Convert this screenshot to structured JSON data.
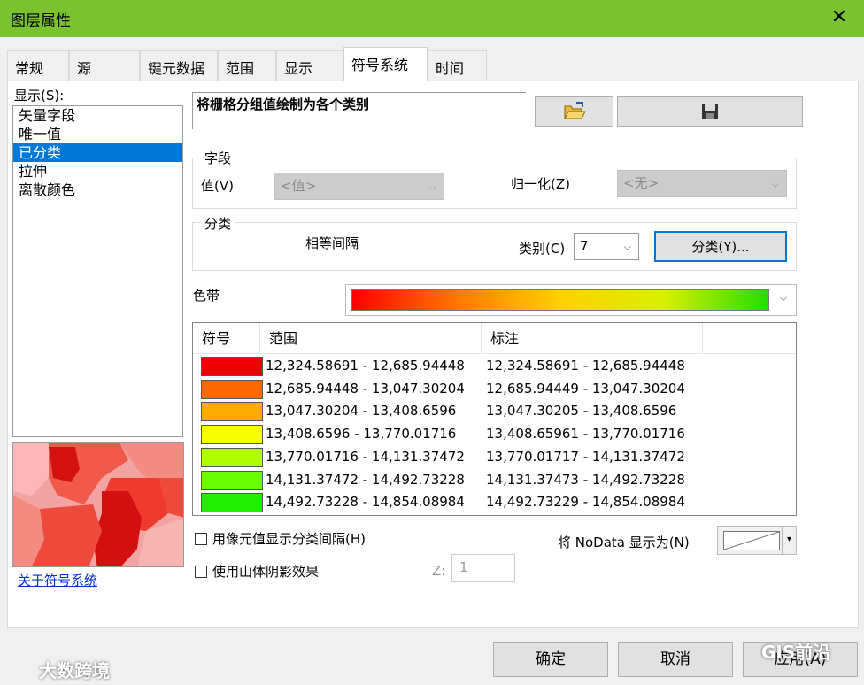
{
  "window": {
    "title": "图层属性",
    "close_glyph": "✕"
  },
  "tabs": [
    "常规",
    "源",
    "键元数据",
    "范围",
    "显示",
    "符号系统",
    "时间"
  ],
  "show_label": "显示(S):",
  "show_list": [
    "矢量字段",
    "唯一值",
    "已分类",
    "拉伸",
    "离散颜色"
  ],
  "selected_show": "已分类",
  "description": "将栅格分组值绘制为各个类别",
  "toolbar": {
    "open_icon": "folder-open-icon",
    "save_icon": "save-disk-icon"
  },
  "field_group": {
    "title": "字段",
    "value_label": "值(V)",
    "value_selected": "<值>",
    "normalize_label": "归一化(Z)",
    "normalize_selected": "<无>"
  },
  "classification_group": {
    "title": "分类",
    "method": "相等间隔",
    "classes_label": "类别(C)",
    "classes_value": "7",
    "classify_button": "分类(Y)..."
  },
  "color_ramp": {
    "label": "色带",
    "colors": [
      "#ff0000",
      "#ff7700",
      "#ffd000",
      "#d8f000",
      "#22dd00"
    ]
  },
  "table": {
    "headers": [
      "符号",
      "范围",
      "标注"
    ],
    "rows": [
      {
        "color": "#ee0000",
        "range": "12,324.58691 - 12,685.94448",
        "label": "12,324.58691 - 12,685.94448"
      },
      {
        "color": "#ff6a00",
        "range": "12,685.94448 - 13,047.30204",
        "label": "12,685.94449 - 13,047.30204"
      },
      {
        "color": "#ffaa00",
        "range": "13,047.30204 - 13,408.6596",
        "label": "13,047.30205 - 13,408.6596"
      },
      {
        "color": "#f5ff00",
        "range": "13,408.6596 - 13,770.01716",
        "label": "13,408.65961 - 13,770.01716"
      },
      {
        "color": "#b0ff00",
        "range": "13,770.01716 - 14,131.37472",
        "label": "13,770.01717 - 14,131.37472"
      },
      {
        "color": "#6aff00",
        "range": "14,131.37472 - 14,492.73228",
        "label": "14,131.37473 - 14,492.73228"
      },
      {
        "color": "#22ee00",
        "range": "14,492.73228 - 14,854.08984",
        "label": "14,492.73229 - 14,854.08984"
      }
    ]
  },
  "options": {
    "pixel_interval": "用像元值显示分类间隔(H)",
    "hillshade": "使用山体阴影效果",
    "z_label": "Z:",
    "z_value": "1",
    "nodata_label": "将 NoData 显示为(N)"
  },
  "about_link": "关于符号系统",
  "buttons": {
    "ok": "确定",
    "cancel": "取消",
    "apply": "应用(A)"
  },
  "watermarks": {
    "left": "大数跨境",
    "right": "GIS前沿"
  }
}
